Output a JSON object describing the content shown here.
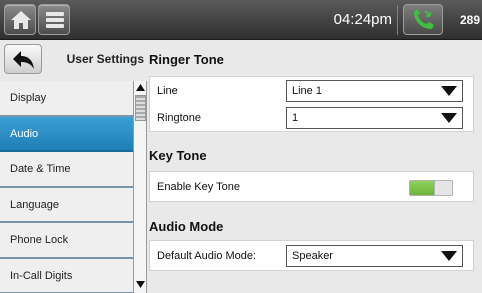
{
  "topbar": {
    "time": "04:24pm",
    "extension": "289",
    "icons": {
      "home": "home-icon",
      "menu": "menu-list-icon",
      "call": "phone-call-icon"
    }
  },
  "sidebar": {
    "title": "User Settings",
    "back_icon": "back-arrow-icon",
    "items": [
      {
        "label": "Display"
      },
      {
        "label": "Audio",
        "active": true
      },
      {
        "label": "Date & Time"
      },
      {
        "label": "Language"
      },
      {
        "label": "Phone Lock"
      },
      {
        "label": "In-Call Digits"
      }
    ]
  },
  "ringer_tone": {
    "title": "Ringer Tone",
    "line_label": "Line",
    "line_value": "Line 1",
    "ringtone_label": "Ringtone",
    "ringtone_value": "1"
  },
  "key_tone": {
    "title": "Key Tone",
    "enable_label": "Enable Key Tone",
    "enabled": true
  },
  "audio_mode": {
    "title": "Audio Mode",
    "default_label": "Default Audio Mode:",
    "default_value": "Speaker"
  },
  "colors": {
    "active_item": "#2a8fca",
    "toggle_on": "#7cc24a",
    "call_icon": "#3fbf3f"
  }
}
